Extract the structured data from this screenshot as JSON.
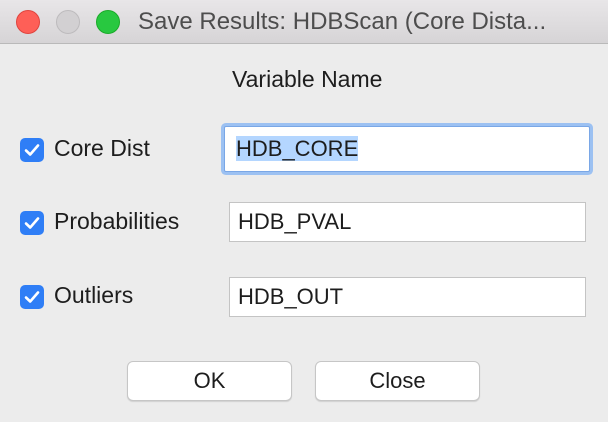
{
  "window": {
    "title": "Save Results: HDBScan (Core Dista..."
  },
  "header": {
    "variable_name_label": "Variable Name"
  },
  "rows": [
    {
      "label": "Core Dist",
      "checked": true,
      "value": "HDB_CORE",
      "focused": true
    },
    {
      "label": "Probabilities",
      "checked": true,
      "value": "HDB_PVAL",
      "focused": false
    },
    {
      "label": "Outliers",
      "checked": true,
      "value": "HDB_OUT",
      "focused": false
    }
  ],
  "buttons": {
    "ok_label": "OK",
    "close_label": "Close"
  },
  "colors": {
    "checkbox_accent": "#2f7ef6",
    "focus_ring": "#9cc1f2",
    "selection": "#b4d6ff"
  }
}
